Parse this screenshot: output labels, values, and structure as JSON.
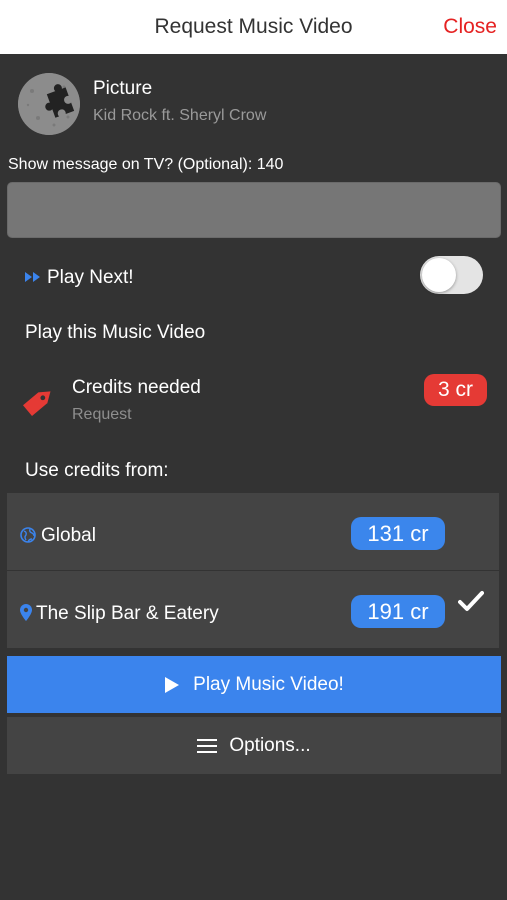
{
  "header": {
    "title": "Request Music Video",
    "close_label": "Close"
  },
  "song": {
    "title": "Picture",
    "artist": "Kid Rock ft. Sheryl Crow",
    "art_icon": "puzzle-piece-icon"
  },
  "message": {
    "label": "Show message on TV? (Optional): 140",
    "value": "",
    "placeholder": ""
  },
  "play_next": {
    "icon": "fast-forward-icon",
    "label": "Play Next!",
    "enabled": false
  },
  "section_play": "Play this Music Video",
  "credits": {
    "icon": "price-tag-icon",
    "title": "Credits needed",
    "subtitle": "Request",
    "badge": "3 cr"
  },
  "section_use": "Use credits from:",
  "accounts": [
    {
      "icon": "globe-icon",
      "name": "Global",
      "badge": "131 cr",
      "selected": false
    },
    {
      "icon": "location-pin-icon",
      "name": "The Slip Bar & Eatery",
      "badge": "191 cr",
      "selected": true
    }
  ],
  "actions": {
    "play_label": "Play Music Video!",
    "play_icon": "play-icon",
    "options_label": "Options...",
    "options_icon": "menu-icon"
  },
  "colors": {
    "background": "#333333",
    "close": "#e52222",
    "accent_blue": "#3b84ed",
    "badge_red": "#e53a35",
    "secondary_text": "#9a9a9a"
  }
}
